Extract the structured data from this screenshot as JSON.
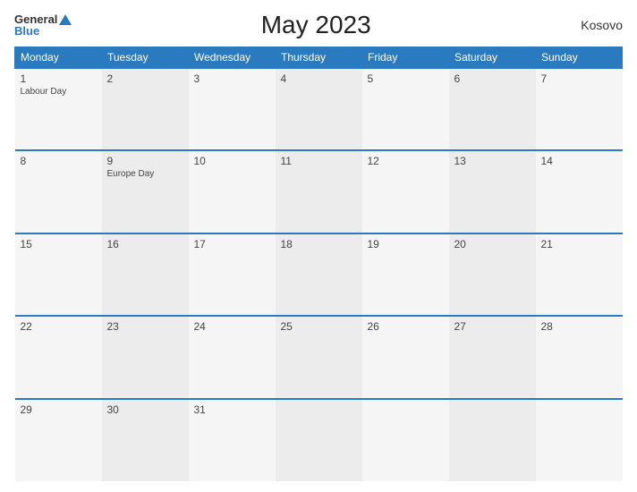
{
  "header": {
    "logo": {
      "general": "General",
      "blue": "Blue",
      "triangle": true
    },
    "title": "May 2023",
    "region": "Kosovo"
  },
  "calendar": {
    "weekdays": [
      "Monday",
      "Tuesday",
      "Wednesday",
      "Thursday",
      "Friday",
      "Saturday",
      "Sunday"
    ],
    "weeks": [
      [
        {
          "day": "1",
          "event": "Labour Day"
        },
        {
          "day": "2",
          "event": ""
        },
        {
          "day": "3",
          "event": ""
        },
        {
          "day": "4",
          "event": ""
        },
        {
          "day": "5",
          "event": ""
        },
        {
          "day": "6",
          "event": ""
        },
        {
          "day": "7",
          "event": ""
        }
      ],
      [
        {
          "day": "8",
          "event": ""
        },
        {
          "day": "9",
          "event": "Europe Day"
        },
        {
          "day": "10",
          "event": ""
        },
        {
          "day": "11",
          "event": ""
        },
        {
          "day": "12",
          "event": ""
        },
        {
          "day": "13",
          "event": ""
        },
        {
          "day": "14",
          "event": ""
        }
      ],
      [
        {
          "day": "15",
          "event": ""
        },
        {
          "day": "16",
          "event": ""
        },
        {
          "day": "17",
          "event": ""
        },
        {
          "day": "18",
          "event": ""
        },
        {
          "day": "19",
          "event": ""
        },
        {
          "day": "20",
          "event": ""
        },
        {
          "day": "21",
          "event": ""
        }
      ],
      [
        {
          "day": "22",
          "event": ""
        },
        {
          "day": "23",
          "event": ""
        },
        {
          "day": "24",
          "event": ""
        },
        {
          "day": "25",
          "event": ""
        },
        {
          "day": "26",
          "event": ""
        },
        {
          "day": "27",
          "event": ""
        },
        {
          "day": "28",
          "event": ""
        }
      ],
      [
        {
          "day": "29",
          "event": ""
        },
        {
          "day": "30",
          "event": ""
        },
        {
          "day": "31",
          "event": ""
        },
        {
          "day": "",
          "event": ""
        },
        {
          "day": "",
          "event": ""
        },
        {
          "day": "",
          "event": ""
        },
        {
          "day": "",
          "event": ""
        }
      ]
    ]
  }
}
